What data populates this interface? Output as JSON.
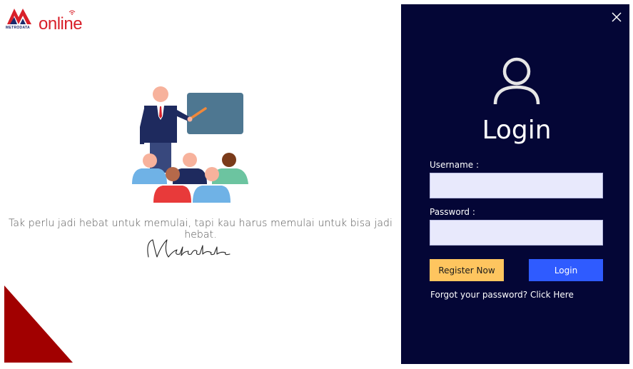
{
  "brand": {
    "logo_word": "online",
    "logo_sub": "METRODATA",
    "color_red": "#d8202a",
    "color_navy": "#1a2a6c"
  },
  "left": {
    "quote": "Tak perlu jadi hebat untuk memulai, tapi kau harus memulai untuk bisa jadi hebat.",
    "signature": "Metrodata",
    "illustration_icon": "teacher-classroom-illustration"
  },
  "login": {
    "title": "Login",
    "username_label": "Username :",
    "username_value": "",
    "password_label": "Password :",
    "password_value": "",
    "register_label": "Register Now",
    "login_label": "Login",
    "forgot_label": "Forgot your password? Click Here",
    "close_icon": "close-icon",
    "user_icon": "user-icon"
  },
  "colors": {
    "panel_bg": "#040636",
    "register_bg": "#fec55f",
    "login_bg": "#2f5bff",
    "field_bg": "#e8e9fc",
    "bottom_triangle": "#a10000"
  }
}
